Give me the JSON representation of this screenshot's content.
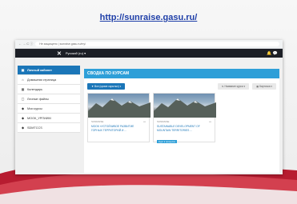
{
  "slide": {
    "url": "http://sunraise.gasu.ru/"
  },
  "browser": {
    "nav": "← → C ⓘ",
    "address": "Не защищено | sunraise.gasu.ru/my/"
  },
  "topbar": {
    "close": "✕",
    "lang": "Русский (ru) ▾",
    "icons": "🔔 💬"
  },
  "sidebar": {
    "items": [
      {
        "label": "Личный кабинет",
        "icon": "▣"
      },
      {
        "label": "Домашняя страница",
        "icon": "⌂"
      },
      {
        "label": "Календарь",
        "icon": "▦"
      },
      {
        "label": "Личные файлы",
        "icon": "▢"
      },
      {
        "label": "Мои курсы",
        "icon": "◆"
      },
      {
        "label": "МООК_УРПИИМ",
        "icon": "◆"
      },
      {
        "label": "SDMTCCS",
        "icon": "◆"
      }
    ]
  },
  "main": {
    "header": "СВОДКА ПО КУРСАМ",
    "filter": "▼ Все (кроме скрытых) ▾",
    "sort": "⇅ Название курса ▾",
    "view": "▦ Карточка ▾",
    "cards": [
      {
        "category": "SUNRAISE",
        "menu": "•••",
        "title": "МООК «Устойчивое развитие горных территорий и ...",
        "badge": ""
      },
      {
        "category": "SUNRAISE",
        "menu": "•••",
        "title": "SUSTAINABLE DEVELOPMENT OF MOUNTAIN TERRITORIES ...",
        "badge": "Курс в процессе"
      }
    ]
  }
}
